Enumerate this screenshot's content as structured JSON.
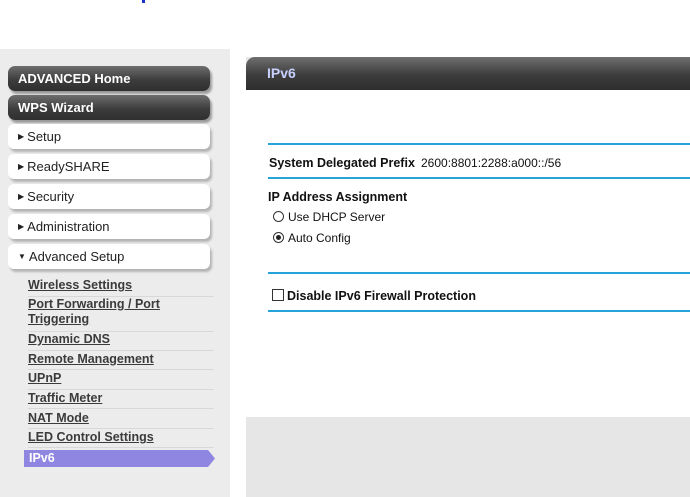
{
  "sidebar": {
    "advanced_home": "ADVANCED Home",
    "wps_wizard": "WPS Wizard",
    "sections": [
      {
        "label": "Setup",
        "expanded": false
      },
      {
        "label": "ReadySHARE",
        "expanded": false
      },
      {
        "label": "Security",
        "expanded": false
      },
      {
        "label": "Administration",
        "expanded": false
      },
      {
        "label": "Advanced Setup",
        "expanded": true
      }
    ],
    "submenu": [
      {
        "label": "Wireless Settings"
      },
      {
        "label": "Port Forwarding / Port Triggering"
      },
      {
        "label": "Dynamic DNS"
      },
      {
        "label": "Remote Management"
      },
      {
        "label": "UPnP"
      },
      {
        "label": "Traffic Meter"
      },
      {
        "label": "NAT Mode"
      },
      {
        "label": "LED Control Settings"
      },
      {
        "label": "IPv6",
        "active": true
      }
    ]
  },
  "main": {
    "title": "IPv6",
    "prefix_label": "System Delegated Prefix",
    "prefix_value": "2600:8801:2288:a000::/56",
    "ip_assignment_label": "IP Address Assignment",
    "options": [
      {
        "label": "Use DHCP Server",
        "checked": false
      },
      {
        "label": "Auto Config",
        "checked": true
      }
    ],
    "firewall_label": "Disable IPv6 Firewall Protection",
    "firewall_checked": false
  },
  "colors": {
    "accent_line": "#27a3dc",
    "active_item": "#8e86e0",
    "header_title": "#c8d0ff"
  }
}
